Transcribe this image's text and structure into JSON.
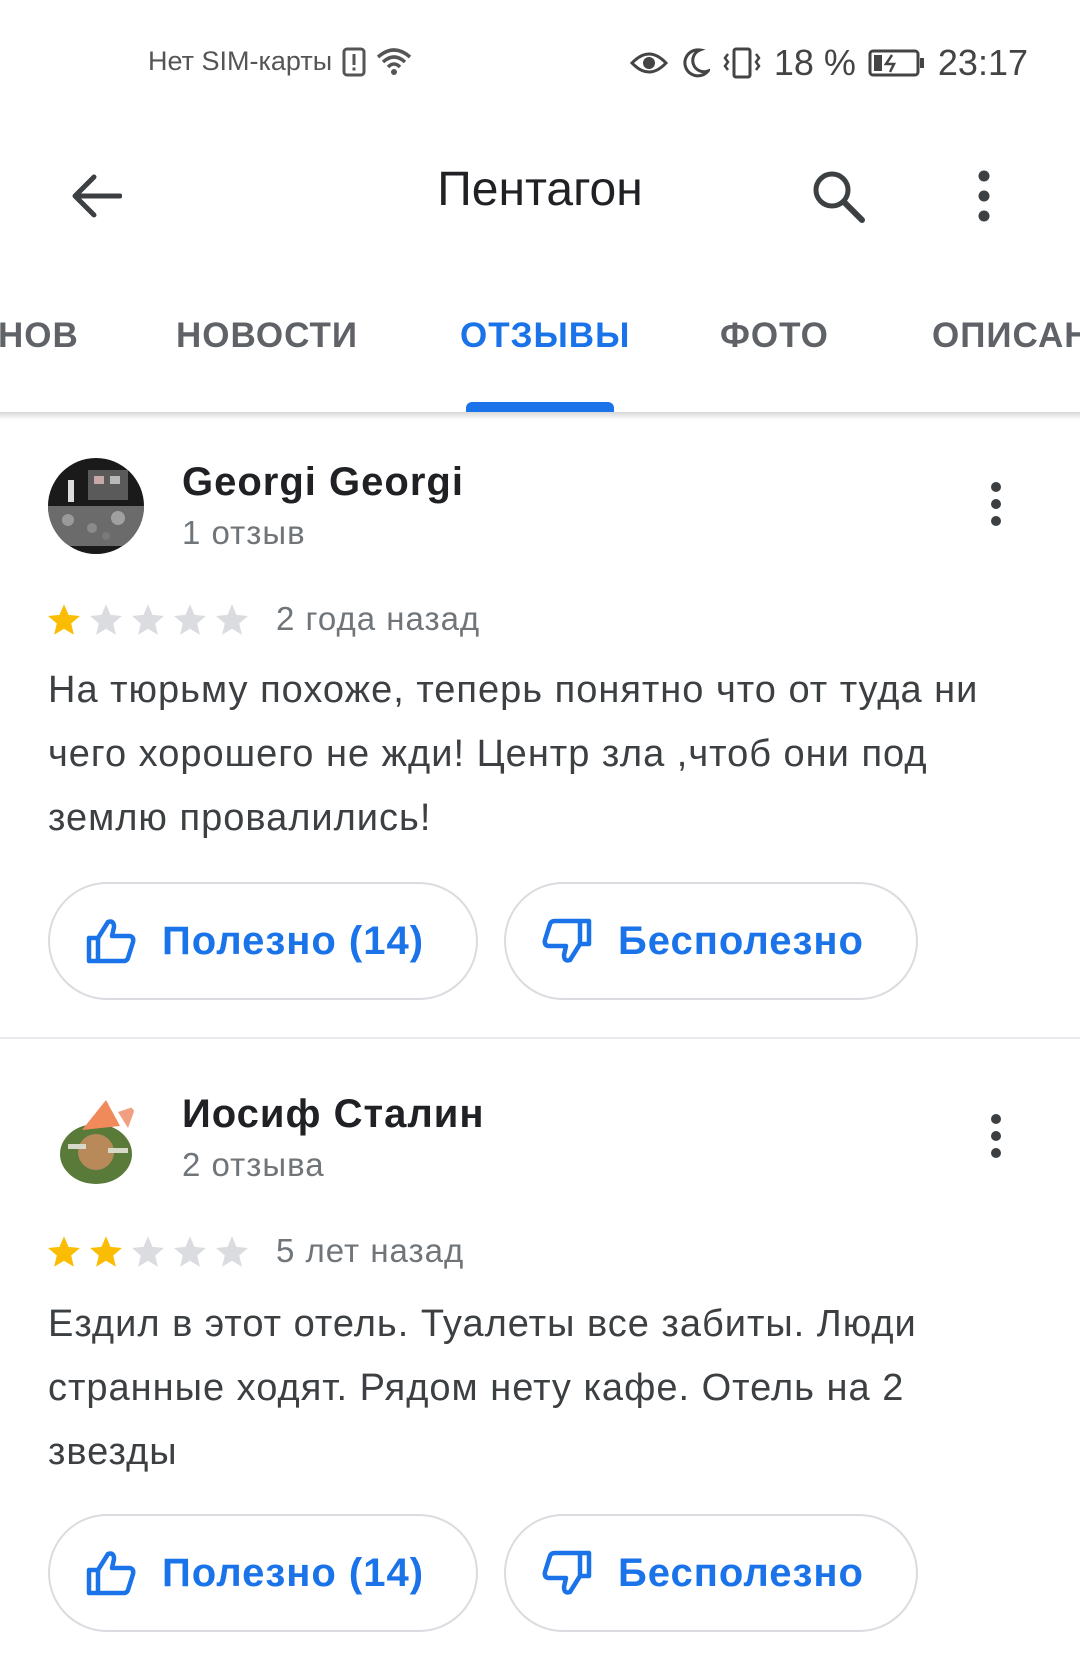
{
  "status_bar": {
    "carrier": "Нет SIM-карты",
    "battery_percent": "18 %",
    "time": "23:17"
  },
  "app_bar": {
    "title": "Пентагон"
  },
  "tabs": [
    {
      "label": "НОВ",
      "active": false
    },
    {
      "label": "НОВОСТИ",
      "active": false
    },
    {
      "label": "ОТЗЫВЫ",
      "active": true
    },
    {
      "label": "ФОТО",
      "active": false
    },
    {
      "label": "ОПИСАН",
      "active": false
    }
  ],
  "colors": {
    "accent": "#1a73e8",
    "star_filled": "#fbbc04",
    "star_empty": "#dadce0"
  },
  "reviews": [
    {
      "author": "Georgi Georgi",
      "count": "1 отзыв",
      "rating": 1,
      "date": "2 года назад",
      "text": "На тюрьму похоже, теперь понятно что от туда ни чего хорошего не жди! Центр зла ,чтоб они под землю провалились!",
      "helpful_label": "Полезно (14)",
      "unhelpful_label": "Бесполезно"
    },
    {
      "author": "Иосиф Сталин",
      "count": "2 отзыва",
      "rating": 2,
      "date": "5 лет назад",
      "text": "Ездил в этот отель. Туалеты все забиты. Люди странные ходят. Рядом нету кафе. Отель на 2 звезды",
      "helpful_label": "Полезно (14)",
      "unhelpful_label": "Бесполезно"
    }
  ]
}
